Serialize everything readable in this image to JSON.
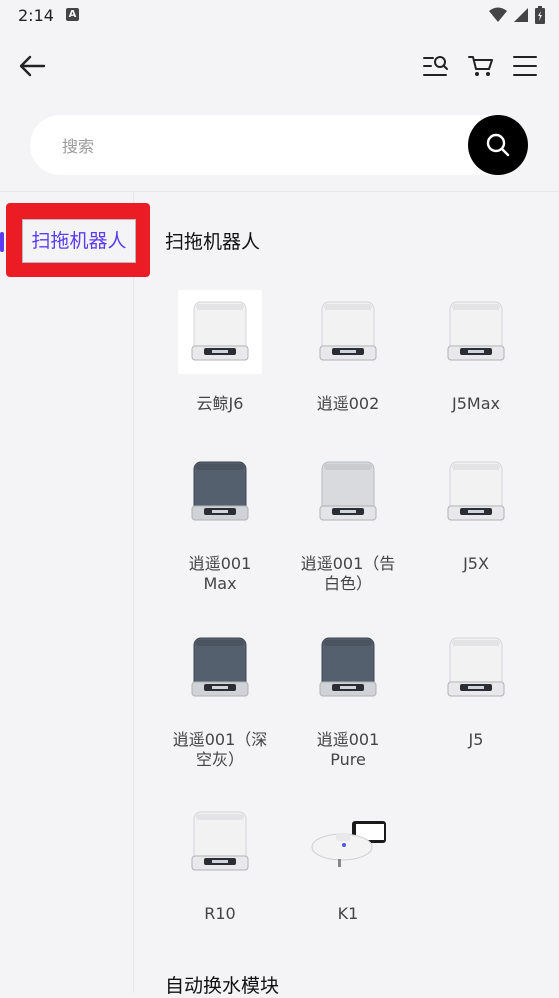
{
  "status": {
    "time": "2:14",
    "a_badge": "A"
  },
  "search": {
    "placeholder": "搜索"
  },
  "sidebar": {
    "items": [
      {
        "label": "扫拖机器人",
        "selected": true
      }
    ]
  },
  "sections": [
    {
      "title": "扫拖机器人",
      "products": [
        {
          "name": "云鲸J6",
          "color": "white"
        },
        {
          "name": "逍遥002",
          "color": "white"
        },
        {
          "name": "J5Max",
          "color": "white"
        },
        {
          "name": "逍遥001\nMax",
          "color": "gray"
        },
        {
          "name": "逍遥001（告\n白色）",
          "color": "silver"
        },
        {
          "name": "J5X",
          "color": "white"
        },
        {
          "name": "逍遥001（深\n空灰）",
          "color": "gray"
        },
        {
          "name": "逍遥001\nPure",
          "color": "gray"
        },
        {
          "name": "J5",
          "color": "white"
        },
        {
          "name": "R10",
          "color": "white"
        },
        {
          "name": "K1",
          "color": "white"
        }
      ]
    },
    {
      "title": "自动换水模块"
    }
  ],
  "colors": {
    "accent": "#5b3cf0",
    "highlight": "#ec1c24"
  }
}
